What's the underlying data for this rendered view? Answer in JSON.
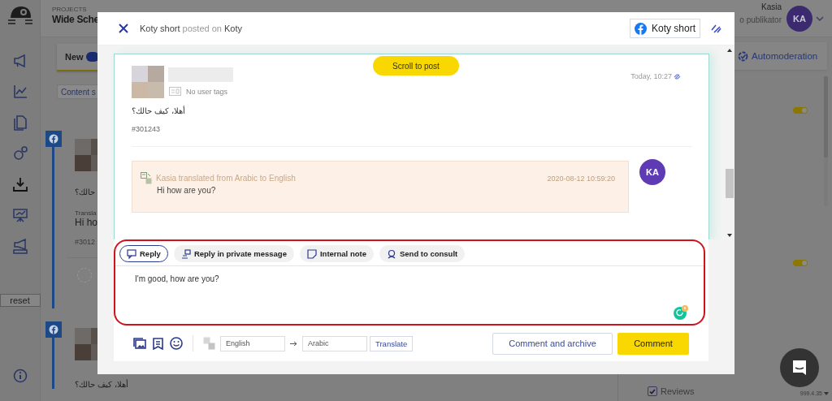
{
  "sidebar": {
    "reset_button": "reset"
  },
  "feed": {
    "project_label": "PROJECTS",
    "project_name": "Wide Sche",
    "tab": "New",
    "filter_button": "Content s",
    "posts": [
      {
        "text": "حالك؟",
        "translation_label": "Transla",
        "translation": "Hi ho",
        "id": "#3012"
      },
      {
        "text": "أهلا، كيف حالك؟"
      }
    ]
  },
  "user": {
    "name": "Kasia",
    "role": "o publikator",
    "initials": "KA"
  },
  "automoderation_button": "Automoderation",
  "toggles": [
    {
      "on": true
    },
    {
      "on": true
    }
  ],
  "filters": [
    {
      "label": "Reviews",
      "checked": true
    }
  ],
  "version": "999.4.35",
  "modal": {
    "title": "**Koty short** posted on **Koty**",
    "account": "Koty short",
    "post": {
      "scroll_button": "Scroll to post",
      "tags": "No user tags",
      "time": "Today, 10:27",
      "text": "أهلا، كيف حالك؟",
      "id": "#301243"
    },
    "translation": {
      "note": "Kasia translated from Arabic to English",
      "time": "2020-08-12 10:59:20",
      "text": "Hi how are you?",
      "author_initials": "KA"
    },
    "reply_tabs": [
      {
        "label": "Reply",
        "selected": true,
        "kind": "reply"
      },
      {
        "label": "Reply in private message",
        "selected": false,
        "kind": "private"
      },
      {
        "label": "Internal note",
        "selected": false,
        "kind": "note"
      },
      {
        "label": "Send to consult",
        "selected": false,
        "kind": "consult"
      }
    ],
    "reply_text": "I'm good, how are you?",
    "translate": {
      "from": "English",
      "to": "Arabic",
      "button": "Translate"
    },
    "actions": [
      {
        "label": "Comment and archive",
        "kind": "secondary"
      },
      {
        "label": "Comment",
        "kind": "primary"
      }
    ]
  }
}
